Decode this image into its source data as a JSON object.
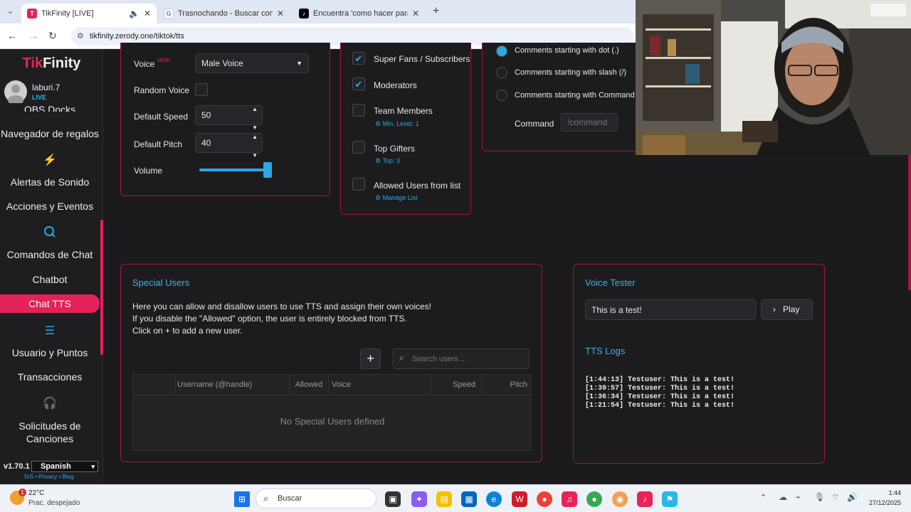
{
  "browser": {
    "tabs": [
      {
        "title": "TikFinity [LIVE]",
        "active": true
      },
      {
        "title": "Trasnochando - Buscar con Google",
        "active": false
      },
      {
        "title": "Encuentra 'como hacer para q",
        "active": false
      }
    ],
    "url": "tikfinity.zerody.one/tiktok/tts"
  },
  "sidebar": {
    "logo_a": "Tik",
    "logo_b": "Finity",
    "username": "laburi.7",
    "live_badge": "LIVE",
    "items": {
      "obs": "OBS Docks",
      "gifts": "Navegador de regalos",
      "sound_alerts": "Alertas de Sonido",
      "actions": "Acciones y Eventos",
      "chat_commands": "Comandos de Chat",
      "chatbot": "Chatbot",
      "chat_tts": "Chat TTS",
      "users_points": "Usuario y Puntos",
      "transactions": "Transacciones",
      "song_requests": "Solicitudes de Canciones"
    },
    "version": "v1.70.1",
    "language": "Spanish",
    "footer_links": "ToS • Privacy • Blog"
  },
  "voice_settings": {
    "voice_label": "Voice",
    "new_badge": "NEW!",
    "voice_value": "Male Voice",
    "random_voice_label": "Random Voice",
    "default_speed_label": "Default Speed",
    "default_speed_value": "50",
    "default_pitch_label": "Default Pitch",
    "default_pitch_value": "40",
    "volume_label": "Volume",
    "volume_level": 1.0
  },
  "allowed_users": {
    "super_fans": "Super Fans / Subscribers",
    "moderators": "Moderators",
    "team_members": "Team Members",
    "team_members_sub": "Min. Level: 1",
    "top_gifters": "Top Gifters",
    "top_gifters_sub": "Top: 3",
    "allowed_list": "Allowed Users from list",
    "allowed_list_sub": "Manage List"
  },
  "comment_filter": {
    "opt_dot": "Comments starting with dot (.)",
    "opt_slash": "Comments starting with slash (/)",
    "opt_command": "Comments starting with Command",
    "command_label": "Command",
    "command_placeholder": "!command"
  },
  "special_users": {
    "title": "Special Users",
    "desc1": "Here you can allow and disallow users to use TTS and assign their own voices!",
    "desc2": "If you disable the \"Allowed\" option, the user is entirely blocked from TTS.",
    "desc3": "Click on + to add a new user.",
    "add_button": "+",
    "search_placeholder": "Search users...",
    "columns": [
      "Username (@handle)",
      "Allowed",
      "Voice",
      "Speed",
      "Pitch"
    ],
    "empty": "No Special Users defined"
  },
  "voice_tester": {
    "title": "Voice Tester",
    "input_value": "This is a test!",
    "play_label": "Play",
    "logs_title": "TTS Logs",
    "logs": [
      "[1:44:13] Testuser: This is a test!",
      "[1:39:57] Testuser: This is a test!",
      "[1:36:34] Testuser: This is a test!",
      "[1:21:54] Testuser: This is a test!"
    ]
  },
  "taskbar": {
    "weather_temp": "22°C",
    "weather_desc": "Prac. despejado",
    "search_label": "Buscar",
    "time": "1:44",
    "date": "27/12/2025"
  },
  "colors": {
    "accent": "#e3225a",
    "link": "#2ea8e0",
    "card_border": "#a3163c"
  }
}
